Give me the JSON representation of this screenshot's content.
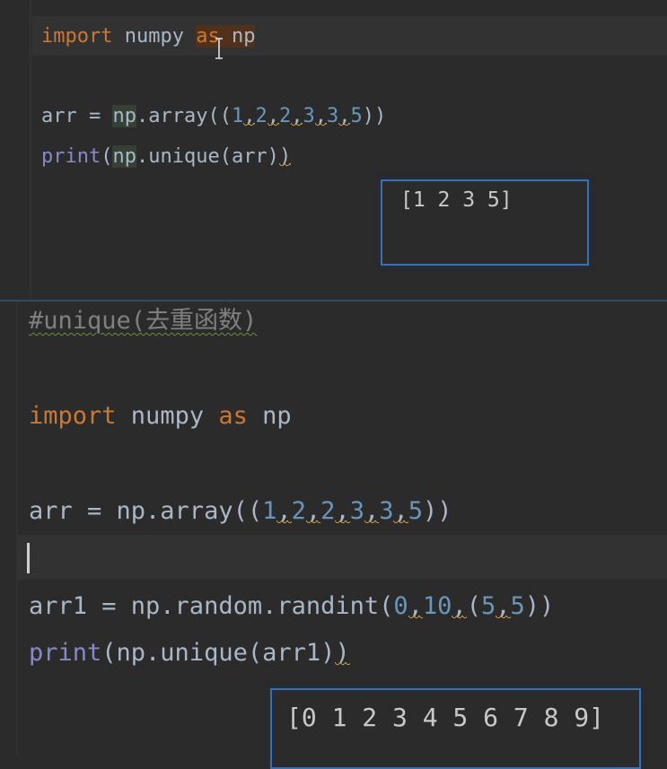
{
  "top_editor": {
    "lines": [
      {
        "kw1": "import",
        "mod": " numpy ",
        "kw2a": "a",
        "kw2b": "s",
        "alias": " np"
      },
      {
        "var": "arr = ",
        "ns": "np",
        "call": ".array((",
        "n1": "1",
        "c1": ",",
        "n2": "2",
        "c2": ",",
        "n3": "2",
        "c3": ",",
        "n4": "3",
        "c4": ",",
        "n5": "3",
        "c5": ",",
        "n6": "5",
        "close": "))"
      },
      {
        "fn": "print",
        "open": "(",
        "ns": "np",
        "call": ".unique(arr)",
        "close": ")"
      }
    ],
    "output": "[1 2 3 5]"
  },
  "bottom_editor": {
    "comment": "#unique(去重函数)",
    "import_line": {
      "kw1": "import",
      "mod": " numpy ",
      "kw2": "as",
      "alias": " np"
    },
    "arr_line": {
      "pre": "arr = np.array((",
      "n1": "1",
      "c1": ",",
      "n2": "2",
      "c2": ",",
      "n3": "2",
      "c3": ",",
      "n4": "3",
      "c4": ",",
      "n5": "3",
      "c5": ",",
      "n6": "5",
      "close": "))"
    },
    "arr1_line": {
      "pre": "arr1 = np.random.randint(",
      "n1": "0",
      "c1": ",",
      "n2": "10",
      "c2": ",",
      "open": "(",
      "n3": "5",
      "c3": ",",
      "n4": "5",
      "close": "))"
    },
    "print_line": {
      "fn": "print",
      "rest": "(np.unique(arr1)",
      "close": ")"
    },
    "output": "[0 1 2 3 4 5 6 7 8 9]"
  },
  "colors": {
    "keyword": "#cc7832",
    "number": "#6897bb",
    "builtin": "#8888c6",
    "text": "#a9b7c6",
    "output_border": "#3e6fb0"
  }
}
